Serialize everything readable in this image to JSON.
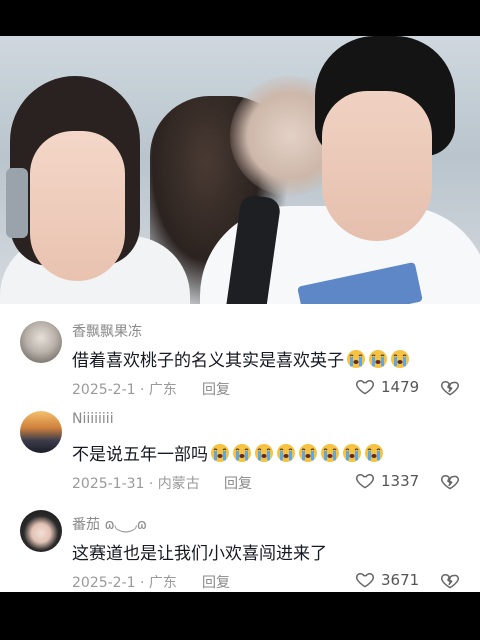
{
  "comments": [
    {
      "name": "香飘飘果冻",
      "text": "借着喜欢桃子的名义其实是喜欢英子",
      "emoji_count": 3,
      "date_location": "2025-2-1 · 广东",
      "reply_label": "回复",
      "likes": "1479"
    },
    {
      "name": "Niiiiiiii",
      "text": "不是说五年一部吗",
      "emoji_count": 8,
      "date_location": "2025-1-31 · 内蒙古",
      "reply_label": "回复",
      "likes": "1337"
    },
    {
      "name": "番茄 ɷ◟‿◞ɷ",
      "text": "这赛道也是让我们小欢喜闯进来了",
      "emoji_count": 0,
      "date_location": "2025-2-1 · 广东",
      "reply_label": "回复",
      "likes": "3671"
    }
  ],
  "icons": {
    "emoji": "loudly-crying-face-icon",
    "like": "heart-outline-icon",
    "dislike": "broken-heart-icon"
  },
  "colors": {
    "name": "#8a8a8a",
    "text": "#161823",
    "meta": "#9a9a9a",
    "emoji_face": "#f5c242",
    "emoji_tears": "#5aa7ea"
  }
}
